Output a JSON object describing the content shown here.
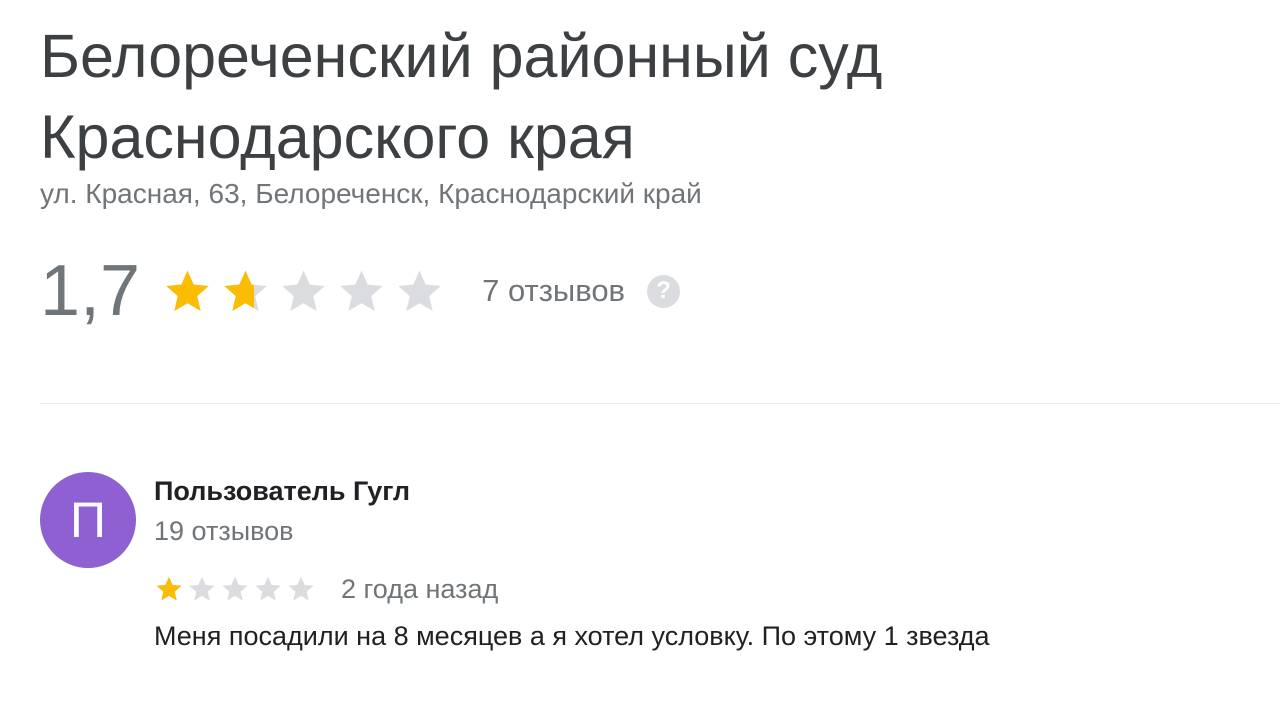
{
  "place": {
    "title_line1": "Белореченский районный суд",
    "title_line2": "Краснодарского края",
    "address": "ул. Красная, 63, Белореченск, Краснодарский край"
  },
  "rating": {
    "value_text": "1,7",
    "value": 1.7,
    "max": 5,
    "reviews_link": "7 отзывов",
    "help_icon": "question-mark-circle-icon",
    "help_glyph": "?"
  },
  "review": {
    "avatar_letter": "П",
    "author": "Пользователь Гугл",
    "author_reviews": "19 отзывов",
    "stars": 1,
    "stars_max": 5,
    "date": "2 года назад",
    "text": "Меня посадили на 8 месяцев а я хотел условку. По этому 1 звезда"
  },
  "colors": {
    "star_filled": "#fbbc04",
    "star_empty": "#dadce0",
    "avatar_bg": "#8e60d2",
    "muted_text": "#70757a"
  }
}
